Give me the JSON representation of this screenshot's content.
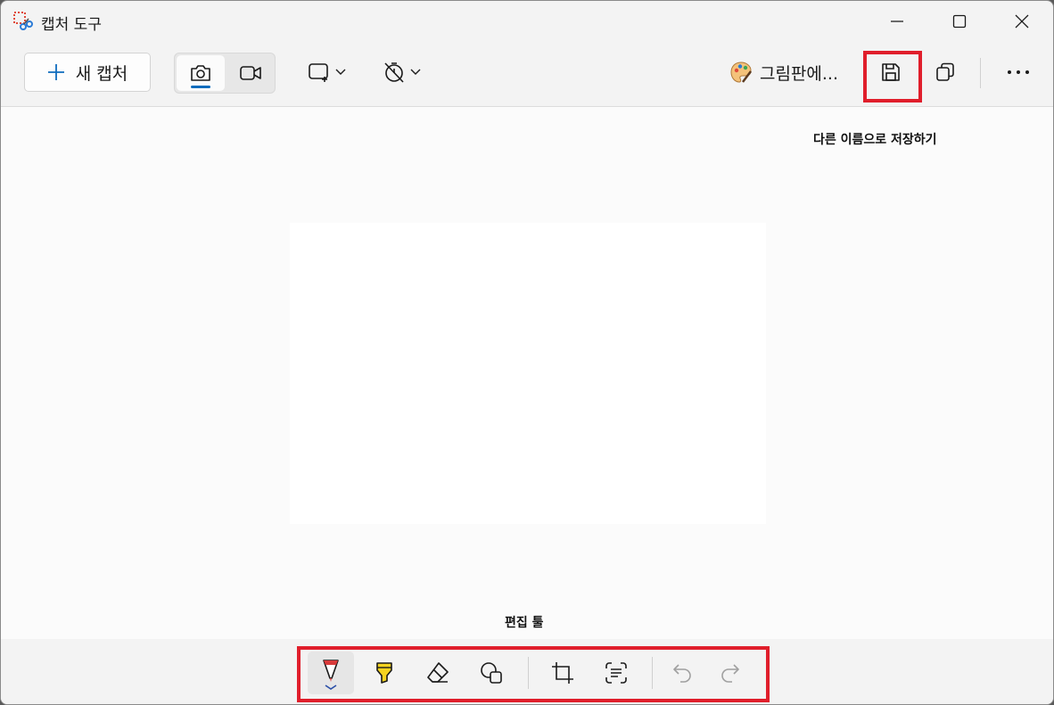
{
  "app": {
    "title": "캡처 도구",
    "accent_color": "#0f6cbd",
    "highlight_color": "#e01e2b"
  },
  "window_controls": {
    "minimize": "minimize-icon",
    "maximize": "maximize-icon",
    "close": "close-icon"
  },
  "toolbar": {
    "new_capture_label": "새 캡처",
    "capture_mode_selected": "photo",
    "capture_modes": [
      "camera-icon",
      "video-camera-icon"
    ],
    "snip_shape_icon": "rectangle-snip-icon",
    "delay_icon": "no-timer-icon",
    "open_in_paint_label": "그림판에...",
    "save_icon": "save-icon",
    "copy_icon": "copy-icon",
    "more_icon": "more-icon"
  },
  "annotations": {
    "save_as": "다른 이름으로 저장하기",
    "edit_tools": "편집 툴"
  },
  "edit_tools": {
    "selected": "ballpoint-pen",
    "items": [
      "ballpoint-pen-icon",
      "highlighter-icon",
      "eraser-icon",
      "shapes-icon",
      "crop-icon",
      "text-actions-icon",
      "undo-icon",
      "redo-icon"
    ]
  }
}
